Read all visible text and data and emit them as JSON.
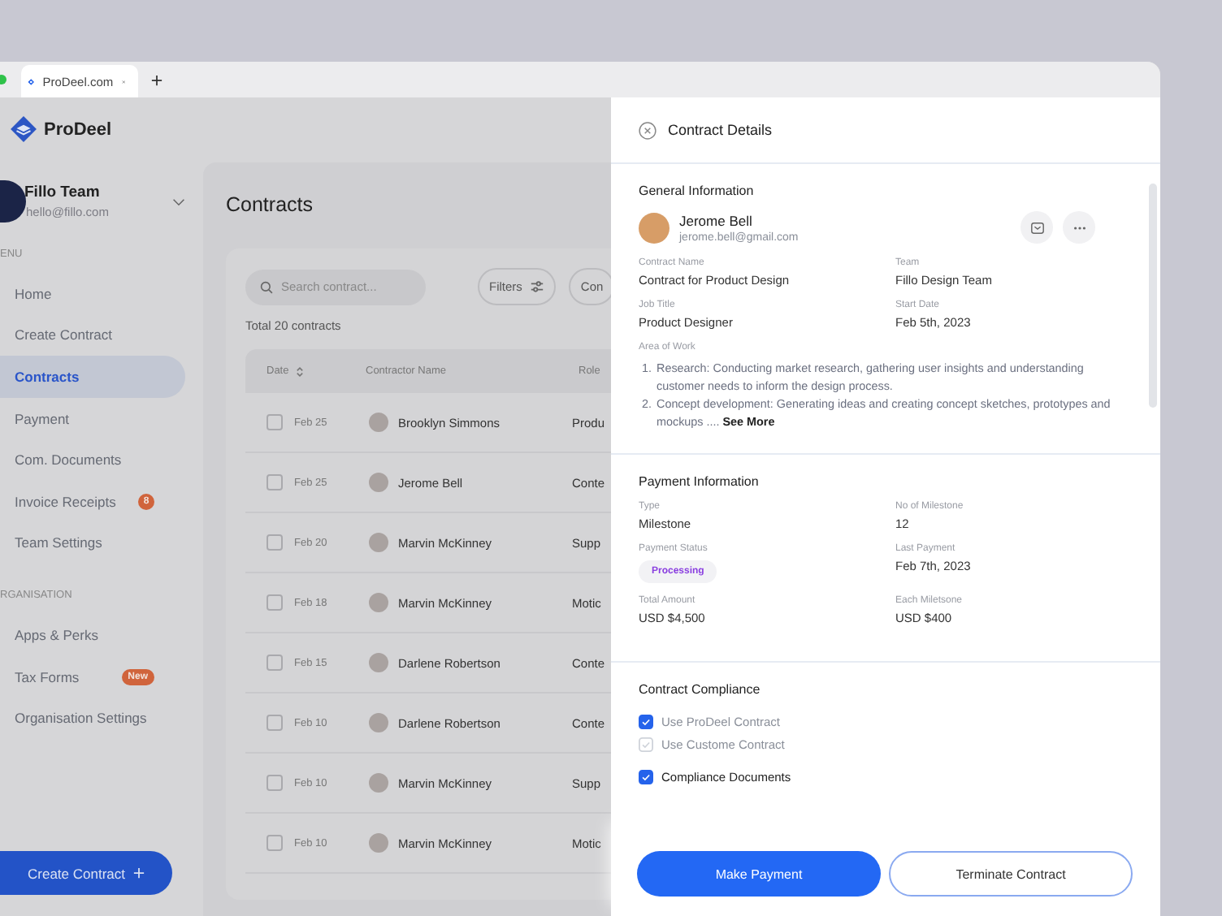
{
  "browser": {
    "tab_title": "ProDeel.com"
  },
  "sidebar": {
    "brand": "ProDeel",
    "team": {
      "name": "Fillo Team",
      "email": "hello@fillo.com"
    },
    "sections": [
      {
        "label": "ENU",
        "items": [
          {
            "label": "Home",
            "selected": false
          },
          {
            "label": "Create Contract",
            "selected": false
          },
          {
            "label": "Contracts",
            "selected": true
          },
          {
            "label": "Payment",
            "selected": false
          },
          {
            "label": "Com. Documents",
            "selected": false
          },
          {
            "label": "Invoice Receipts",
            "selected": false,
            "badge": "8"
          },
          {
            "label": "Team Settings",
            "selected": false
          }
        ]
      },
      {
        "label": "RGANISATION",
        "items": [
          {
            "label": "Apps & Perks",
            "selected": false
          },
          {
            "label": "Tax Forms",
            "selected": false,
            "badge": "New"
          },
          {
            "label": "Organisation Settings",
            "selected": false
          }
        ]
      }
    ],
    "create_button": "Create Contract"
  },
  "main": {
    "title": "Contracts",
    "search": {
      "placeholder": "Search contract..."
    },
    "buttons": [
      "Filters",
      "Con"
    ],
    "total": "Total 20 contracts",
    "table": {
      "columns": [
        "Date",
        "Contractor Name",
        "Role"
      ],
      "rows": [
        {
          "date": "Feb 25",
          "name": "Brooklyn Simmons",
          "role": "Produ",
          "checked": false
        },
        {
          "date": "Feb 25",
          "name": "Jerome Bell",
          "role": "Conte",
          "checked": false
        },
        {
          "date": "Feb 20",
          "name": "Marvin McKinney",
          "role": "Supp",
          "checked": false
        },
        {
          "date": "Feb 18",
          "name": "Marvin McKinney",
          "role": "Motic",
          "checked": false
        },
        {
          "date": "Feb 15",
          "name": "Darlene Robertson",
          "role": "Conte",
          "checked": false
        },
        {
          "date": "Feb 10",
          "name": "Darlene Robertson",
          "role": "Conte",
          "checked": false
        },
        {
          "date": "Feb 10",
          "name": "Marvin McKinney",
          "role": "Supp",
          "checked": false
        },
        {
          "date": "Feb 10",
          "name": "Marvin McKinney",
          "role": "Motic",
          "checked": false
        }
      ]
    }
  },
  "drawer": {
    "title": "Contract Details",
    "general": {
      "heading": "General Information",
      "person": {
        "name": "Jerome Bell",
        "email": "jerome.bell@gmail.com"
      },
      "fields": [
        {
          "label": "Contract Name",
          "value": "Contract for Product Design",
          "kind": "text"
        },
        {
          "label": "Team",
          "value": "Fillo Design Team",
          "kind": "text"
        },
        {
          "label": "Job Title",
          "value": "Product Designer",
          "kind": "text"
        },
        {
          "label": "Start Date",
          "value": "Feb 5th, 2023",
          "kind": "text"
        }
      ],
      "area_label": "Area of Work",
      "area_items": [
        {
          "number": "1.",
          "text": "Research: Conducting market research, gathering user insights and understanding customer needs to inform the design process."
        },
        {
          "number": "2.",
          "text": "Concept development: Generating ideas and creating concept sketches, prototypes and mockups .... **See More**"
        }
      ]
    },
    "payment": {
      "heading": "Payment Information",
      "fields": [
        {
          "label": "Type",
          "value": "Milestone",
          "kind": "text"
        },
        {
          "label": "No of Milestone",
          "value": "12",
          "kind": "text"
        },
        {
          "label": "Payment Status",
          "value": "Processing",
          "kind": "pill"
        },
        {
          "label": "Last Payment",
          "value": "Feb 7th, 2023",
          "kind": "text"
        },
        {
          "label": "Total Amount",
          "value": "USD $4,500",
          "kind": "text"
        },
        {
          "label": "Each Miletsone",
          "value": "USD $400",
          "kind": "text"
        }
      ]
    },
    "compliance": {
      "heading": "Contract Compliance",
      "options": [
        {
          "label": "Use ProDeel Contract",
          "checked": true,
          "kind": "option"
        },
        {
          "label": "Use Custome Contract",
          "checked": false,
          "kind": "option"
        },
        {
          "label": "Compliance Documents",
          "checked": true,
          "kind": "heading"
        }
      ]
    },
    "buttons": {
      "primary": "Make Payment",
      "secondary": "Terminate Contract"
    }
  }
}
